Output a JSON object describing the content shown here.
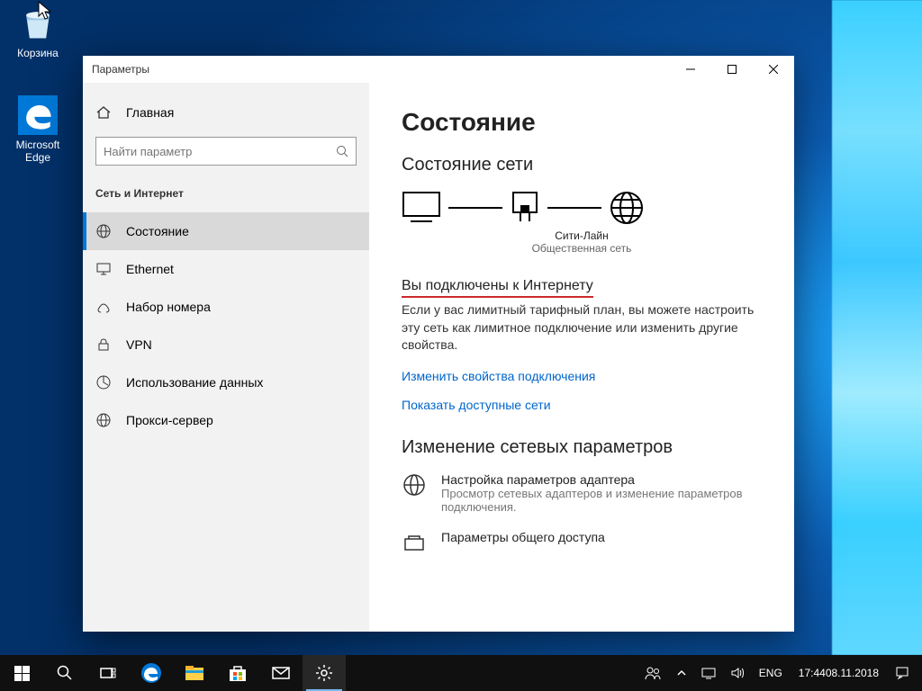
{
  "desktop": {
    "recycle_label": "Корзина",
    "edge_label": "Microsoft Edge"
  },
  "window": {
    "title": "Параметры"
  },
  "sidebar": {
    "home": "Главная",
    "search_placeholder": "Найти параметр",
    "section": "Сеть и Интернет",
    "items": [
      {
        "label": "Состояние"
      },
      {
        "label": "Ethernet"
      },
      {
        "label": "Набор номера"
      },
      {
        "label": "VPN"
      },
      {
        "label": "Использование данных"
      },
      {
        "label": "Прокси-сервер"
      }
    ]
  },
  "main": {
    "title": "Состояние",
    "subtitle": "Состояние сети",
    "net_name": "Сити-Лайн",
    "net_type": "Общественная сеть",
    "connected": "Вы подключены к Интернету",
    "desc": "Если у вас лимитный тарифный план, вы можете настроить эту сеть как лимитное подключение или изменить другие свойства.",
    "link1": "Изменить свойства подключения",
    "link2": "Показать доступные сети",
    "change_heading": "Изменение сетевых параметров",
    "opt1_title": "Настройка параметров адаптера",
    "opt1_desc": "Просмотр сетевых адаптеров и изменение параметров подключения.",
    "opt2_title": "Параметры общего доступа"
  },
  "taskbar": {
    "lang": "ENG",
    "time": "17:44",
    "date": "08.11.2018"
  }
}
